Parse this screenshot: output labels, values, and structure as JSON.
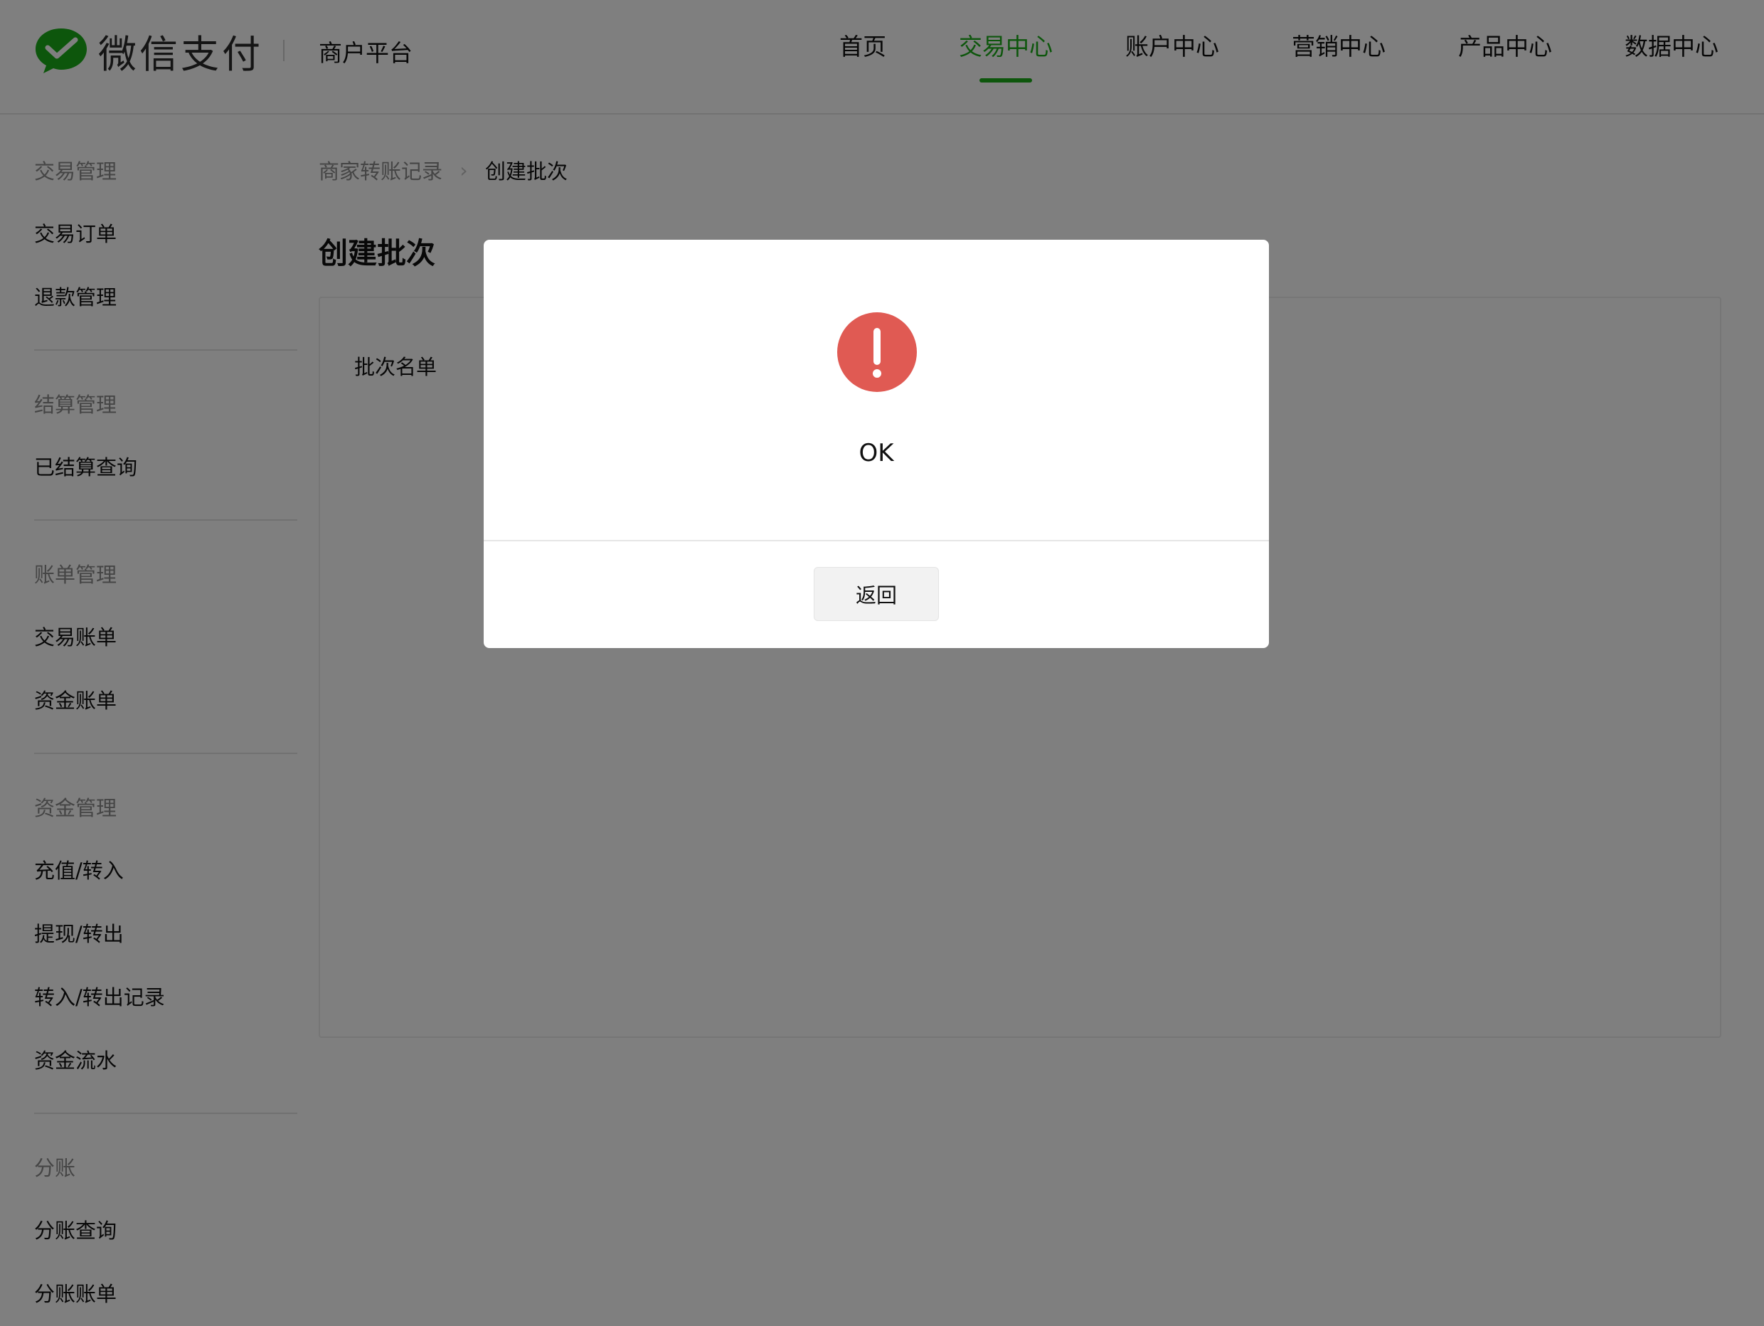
{
  "header": {
    "brand_name": "微信支付",
    "platform_name": "商户平台",
    "brand_color": "#1aad19",
    "nav": [
      {
        "label": "首页",
        "active": false
      },
      {
        "label": "交易中心",
        "active": true
      },
      {
        "label": "账户中心",
        "active": false
      },
      {
        "label": "营销中心",
        "active": false
      },
      {
        "label": "产品中心",
        "active": false
      },
      {
        "label": "数据中心",
        "active": false
      }
    ]
  },
  "sidebar": {
    "groups": [
      {
        "title": "交易管理",
        "items": [
          "交易订单",
          "退款管理"
        ]
      },
      {
        "title": "结算管理",
        "items": [
          "已结算查询"
        ]
      },
      {
        "title": "账单管理",
        "items": [
          "交易账单",
          "资金账单"
        ]
      },
      {
        "title": "资金管理",
        "items": [
          "充值/转入",
          "提现/转出",
          "转入/转出记录",
          "资金流水"
        ]
      },
      {
        "title": "分账",
        "items": [
          "分账查询",
          "分账账单"
        ]
      }
    ]
  },
  "breadcrumb": {
    "parent": "商家转账记录",
    "separator_icon": "chevron-right-icon",
    "current": "创建批次"
  },
  "page": {
    "title": "创建批次",
    "field_label": "批次名单"
  },
  "modal": {
    "icon": "exclamation-circle-icon",
    "icon_color": "#e05a53",
    "message": "OK",
    "back_label": "返回"
  }
}
